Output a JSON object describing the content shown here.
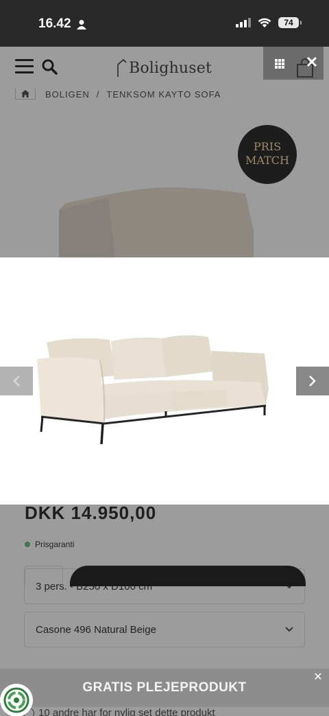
{
  "status_bar": {
    "time": "16.42",
    "battery": "74"
  },
  "header": {
    "logo_text": "Bolighuset",
    "close_symbol": "✕"
  },
  "breadcrumb": {
    "items": [
      "BOLIGEN",
      "TENKSOM KAYTO SOFA"
    ],
    "separator": "/"
  },
  "badge": {
    "line1": "PRIS",
    "line2": "MATCH"
  },
  "product": {
    "price": "DKK 14.950,00",
    "price_guarantee": "Prisgaranti",
    "size_option": "3 pers. - B250 x D100 cm",
    "color_option": "Casone 496 Natural Beige",
    "stock_text": "10 andre har for nylig set dette produkt"
  },
  "lightbox": {
    "prev_icon": "chevron-left-icon",
    "next_icon": "chevron-right-icon"
  },
  "promo": {
    "text": "GRATIS PLEJEPRODUKT",
    "close_symbol": "✕"
  },
  "colors": {
    "overlay": "#9c9c9c",
    "status_bar": "#282828",
    "badge": "#1d1d1d",
    "button": "#1a1a1a",
    "sofa_fabric": "#e9e1d3"
  }
}
